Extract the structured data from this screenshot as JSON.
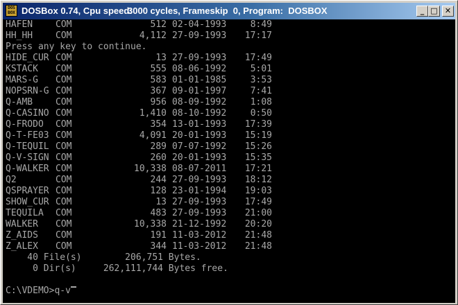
{
  "window": {
    "title": "DOSBox 0.74, Cpu speed:",
    "speed": "3000 cycles, Frameskip  0, Program:  DOSBOX",
    "icon_text": "DOS BOX",
    "buttons": {
      "minimize": "_",
      "maximize": "□",
      "close": "✕"
    }
  },
  "console": {
    "files": [
      {
        "name": "HAFEN",
        "ext": "COM",
        "size": "512",
        "date": "02-04-1993",
        "time": "8:49"
      },
      {
        "name": "HH_HH",
        "ext": "COM",
        "size": "4,112",
        "date": "27-09-1993",
        "time": "17:17"
      },
      {
        "name": "",
        "ext": "",
        "size": "",
        "date": "",
        "time": "",
        "text": "Press any key to continue."
      },
      {
        "name": "HIDE_CUR",
        "ext": "COM",
        "size": "13",
        "date": "27-09-1993",
        "time": "17:49"
      },
      {
        "name": "KSTACK",
        "ext": "COM",
        "size": "555",
        "date": "08-06-1992",
        "time": "5:01"
      },
      {
        "name": "MARS-G",
        "ext": "COM",
        "size": "583",
        "date": "01-01-1985",
        "time": "3:53"
      },
      {
        "name": "NOPSRN-G",
        "ext": "COM",
        "size": "367",
        "date": "09-01-1997",
        "time": "7:41"
      },
      {
        "name": "Q-AMB",
        "ext": "COM",
        "size": "956",
        "date": "08-09-1992",
        "time": "1:08"
      },
      {
        "name": "Q-CASINO",
        "ext": "COM",
        "size": "1,410",
        "date": "08-10-1992",
        "time": "0:50"
      },
      {
        "name": "Q-FRODO",
        "ext": "COM",
        "size": "354",
        "date": "13-01-1993",
        "time": "17:39"
      },
      {
        "name": "Q-T-FE03",
        "ext": "COM",
        "size": "4,091",
        "date": "20-01-1993",
        "time": "15:19"
      },
      {
        "name": "Q-TEQUIL",
        "ext": "COM",
        "size": "289",
        "date": "07-07-1992",
        "time": "15:26"
      },
      {
        "name": "Q-V-SIGN",
        "ext": "COM",
        "size": "260",
        "date": "20-01-1993",
        "time": "15:35"
      },
      {
        "name": "Q-WALKER",
        "ext": "COM",
        "size": "10,338",
        "date": "08-07-2011",
        "time": "17:21"
      },
      {
        "name": "Q2",
        "ext": "COM",
        "size": "244",
        "date": "27-09-1993",
        "time": "18:12"
      },
      {
        "name": "QSPRAYER",
        "ext": "COM",
        "size": "128",
        "date": "23-01-1994",
        "time": "19:03"
      },
      {
        "name": "SHOW_CUR",
        "ext": "COM",
        "size": "13",
        "date": "27-09-1993",
        "time": "17:49"
      },
      {
        "name": "TEQUILA",
        "ext": "COM",
        "size": "483",
        "date": "27-09-1993",
        "time": "21:00"
      },
      {
        "name": "WALKER",
        "ext": "COM",
        "size": "10,338",
        "date": "21-12-1992",
        "time": "20:20"
      },
      {
        "name": "Z_AIDS",
        "ext": "COM",
        "size": "191",
        "date": "11-03-2012",
        "time": "21:48"
      },
      {
        "name": "Z_ALEX",
        "ext": "COM",
        "size": "344",
        "date": "11-03-2012",
        "time": "21:48"
      }
    ],
    "summary": [
      "    40 File(s)        206,751 Bytes.",
      "     0 Dir(s)     262,111,744 Bytes free."
    ],
    "prompt": "C:\\VDEMO>q-v"
  }
}
